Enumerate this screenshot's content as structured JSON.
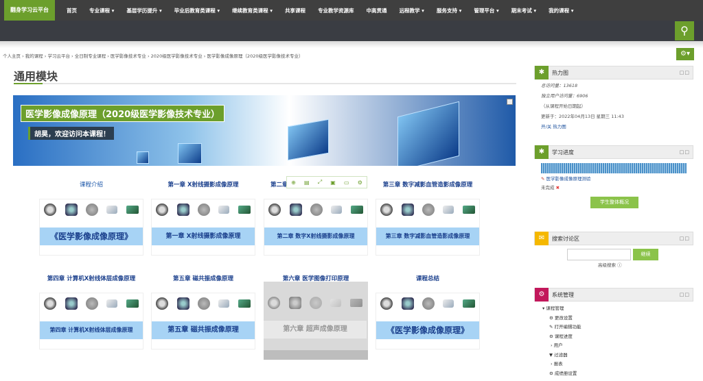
{
  "nav": {
    "brand": "翻身学习云平台",
    "items": [
      "首页",
      "专业课程 ▾",
      "基层学历提升 ▾",
      "毕业后教育类课程 ▾",
      "继续教育类课程 ▾",
      "共享课程",
      "专业教学资源库",
      "中高贯通",
      "远程教学 ▾",
      "服务支持 ▾",
      "管理平台 ▾",
      "期末考试 ▾",
      "我的课程 ▾"
    ]
  },
  "breadcrumb": "个人主页 › 我的课程 › 学习云平台 › 全日制专业课程 › 医学影像技术专业 › 2020级医学影像技术专业 › 医学影像成像原理（2020级医学影像技术专业）",
  "page": {
    "title": "通用模块"
  },
  "banner": {
    "title": "医学影像成像原理（2020级医学影像技术专业）",
    "subtitle": "胡昊，欢迎访问本课程！"
  },
  "cards": [
    {
      "title": "课程介绍",
      "band": "《医学影像成像原理》"
    },
    {
      "title": "第一章 X射线摄影成像原理",
      "band": "第一章 X射线摄影成像原理"
    },
    {
      "title": "第二章",
      "band": "第二章 数字X射线摄影成像原理"
    },
    {
      "title": "第三章 数字减影血管造影成像原理",
      "band": "第三章 数字减影血管造影成像原理"
    },
    {
      "title": "第四章 计算机X射线体层成像原理",
      "band": "第四章 计算机X射线体层成像原理"
    },
    {
      "title": "第五章 磁共振成像原理",
      "band": "第五章 磁共振成像原理"
    },
    {
      "title": "第六章 医学图像打印原理",
      "band": "第六章 超声成像原理"
    },
    {
      "title": "课程总结",
      "band": "《医学影像成像原理》"
    }
  ],
  "heatmap": {
    "title": "热力图",
    "visits": "总访问量：13618",
    "unique": "独立用户访问量：6906",
    "since": "（从课程开始日期起）",
    "updated": "更新于：2022年04月13日 星期三 11:43",
    "toggle": "开/关 热力图"
  },
  "progress": {
    "title": "学习进度",
    "item": "医学影像成像原理测验",
    "status": "未完成",
    "button": "学生整体概况"
  },
  "forum": {
    "title": "搜索讨论区",
    "button": "继续",
    "advanced": "高级搜索"
  },
  "admin": {
    "title": "系统管理",
    "items": [
      "▾ 课程管理",
      "更改设置",
      "打开编辑功能",
      "课程进度",
      "› 用户",
      "过滤器",
      "› 报表",
      "成绩册设置"
    ]
  }
}
